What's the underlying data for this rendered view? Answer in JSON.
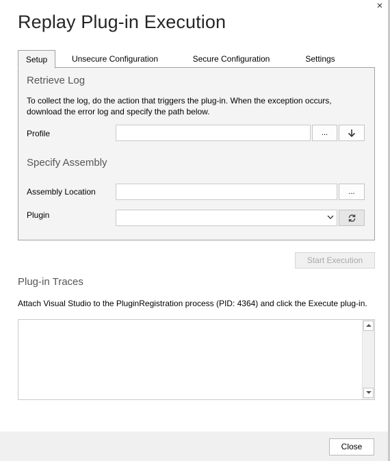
{
  "dialog": {
    "title": "Replay Plug-in Execution",
    "close_glyph": "×"
  },
  "tabs": [
    {
      "label": "Setup",
      "active": true
    },
    {
      "label": "Unsecure Configuration",
      "active": false
    },
    {
      "label": "Secure Configuration",
      "active": false
    },
    {
      "label": "Settings",
      "active": false
    }
  ],
  "setup": {
    "retrieve_log_heading": "Retrieve Log",
    "retrieve_log_description": "To collect the log, do the action that triggers the plug-in. When the exception occurs, download the error log and specify the path below.",
    "profile_label": "Profile",
    "profile_value": "",
    "profile_browse_label": "...",
    "profile_download_icon": "download-arrow-icon",
    "specify_assembly_heading": "Specify Assembly",
    "assembly_location_label": "Assembly Location",
    "assembly_location_value": "",
    "assembly_browse_label": "...",
    "plugin_label": "Plugin",
    "plugin_selected": "",
    "plugin_refresh_icon": "refresh-icon"
  },
  "actions": {
    "start_execution_label": "Start Execution"
  },
  "traces": {
    "heading": "Plug-in Traces",
    "description": "Attach Visual Studio to the PluginRegistration process (PID: 4364) and click the Execute plug-in.",
    "content": ""
  },
  "footer": {
    "close_label": "Close"
  },
  "colors": {
    "panel_bg": "#f4f4f4",
    "border": "#a0a0a0",
    "heading": "#555555",
    "disabled_text": "#a8a8a8",
    "footer_bg": "#f0f0f0"
  }
}
